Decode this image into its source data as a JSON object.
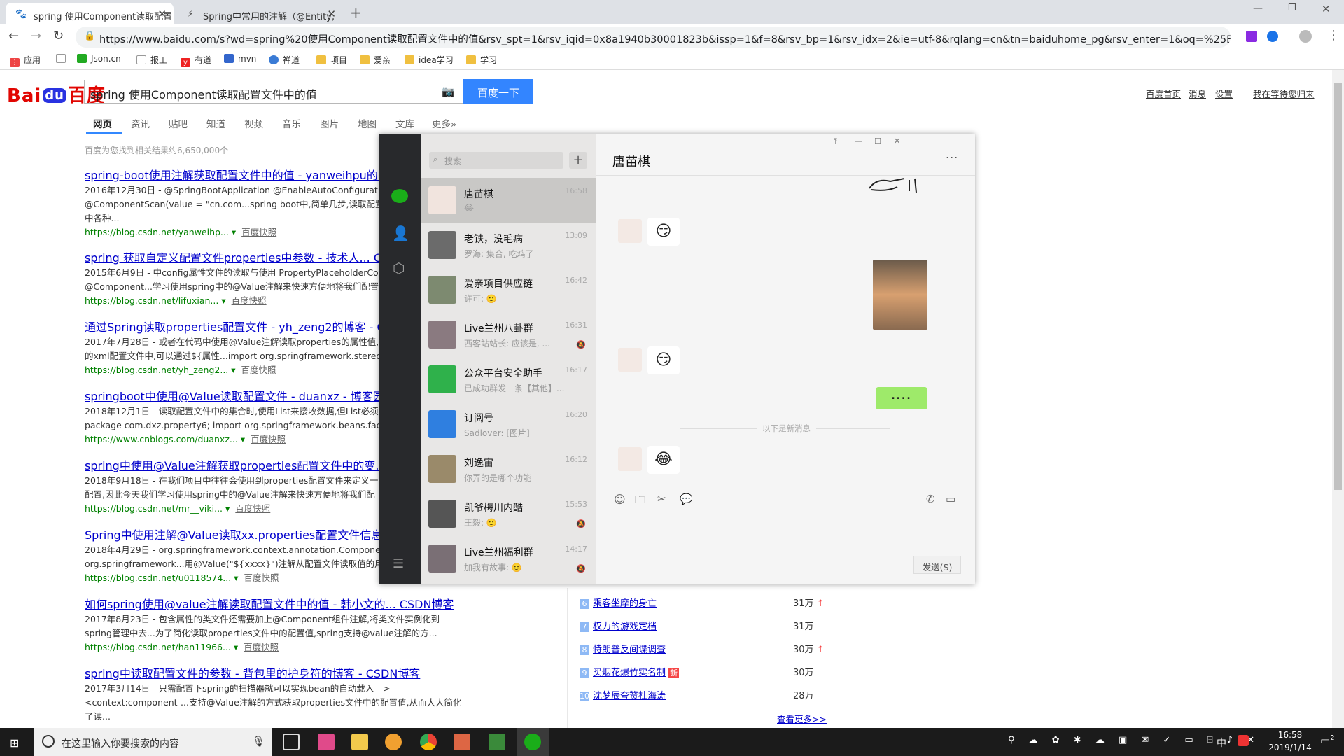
{
  "browser": {
    "tabs": [
      {
        "title": "spring 使用Component读取配置",
        "active": true
      },
      {
        "title": "Spring中常用的注解（@Entity,",
        "active": false
      }
    ],
    "url": "https://www.baidu.com/s?wd=spring%20使用Component读取配置文件中的值&rsv_spt=1&rsv_iqid=0x8a1940b30001823b&issp=1&f=8&rsv_bp=1&rsv_idx=2&ie=utf-8&rqlang=cn&tn=baiduhome_pg&rsv_enter=1&oq=%25E5%25AE...",
    "bookmarks": [
      "应用",
      "Json.cn",
      "报工",
      "有道",
      "mvn",
      "禅道",
      "项目",
      "爱亲",
      "idea学习",
      "学习"
    ]
  },
  "baidu": {
    "logo_left": "Bai",
    "logo_du": "du",
    "logo_right": "百度",
    "query": "spring 使用Component读取配置文件中的值",
    "search_button": "百度一下",
    "top_links": [
      "百度首页",
      "消息",
      "设置",
      "我在等待您归来"
    ],
    "nav": [
      "网页",
      "资讯",
      "贴吧",
      "知道",
      "视频",
      "音乐",
      "图片",
      "地图",
      "文库",
      "更多»"
    ],
    "result_count": "百度为您找到相关结果约6,650,000个",
    "results": [
      {
        "title": "spring-boot使用注解获取配置文件中的值 - yanweihpu的...",
        "desc1": "2016年12月30日 - @SpringBootApplication @EnableAutoConfiguration",
        "desc2": "@ComponentScan(value = \"cn.com...spring boot中,简单几步,读取配置文件",
        "desc3": "中各种...",
        "url": "https://blog.csdn.net/yanweihp...",
        "snap": "百度快照"
      },
      {
        "title": "spring 获取自定义配置文件properties中参数 - 技术人... CSDN",
        "desc1": "2015年6月9日 - 中config属性文件的读取与使用 PropertyPlaceholderConfigurer",
        "desc2": "@Component...学习使用spring中的@Value注解来快速方便地将我们配置",
        "desc3": "",
        "url": "https://blog.csdn.net/lifuxian...",
        "snap": "百度快照"
      },
      {
        "title": "通过Spring读取properties配置文件 - yh_zeng2的博客 - CSDN",
        "desc1": "2017年7月28日 - 或者在代码中使用@Value注解读取properties的属性值,",
        "desc2": "的xml配置文件中,可以通过${属性...import org.springframework.stereotype",
        "desc3": "",
        "url": "https://blog.csdn.net/yh_zeng2...",
        "snap": "百度快照"
      },
      {
        "title": "springboot中使用@Value读取配置文件 - duanxz - 博客园",
        "desc1": "2018年12月1日 - 读取配置文件中的集合时,使用List来接收数据,但List必须",
        "desc2": "package com.dxz.property6; import org.springframework.beans.factory.an",
        "desc3": "",
        "url": "https://www.cnblogs.com/duanxz...",
        "snap": "百度快照"
      },
      {
        "title": "spring中使用@Value注解获取properties配置文件中的变...",
        "desc1": "2018年9月18日 - 在我们项目中往往会使用到properties配置文件来定义一",
        "desc2": "配置,因此今天我们学习使用spring中的@Value注解来快速方便地将我们配",
        "desc3": "",
        "url": "https://blog.csdn.net/mr__viki...",
        "snap": "百度快照"
      },
      {
        "title": "Spring中使用注解@Value读取xx.properties配置文件信息...",
        "desc1": "2018年4月29日 - org.springframework.context.annotation.ComponentScan",
        "desc2": "org.springframework...用@Value(\"${xxxx}\")注解从配置文件读取值的用法",
        "desc3": "",
        "url": "https://blog.csdn.net/u0118574...",
        "snap": "百度快照"
      },
      {
        "title": "如何spring使用@value注解读取配置文件中的值 - 韩小文的... CSDN博客",
        "desc1": "2017年8月23日 - 包含属性的类文件还需要加上@Component组件注解,将类文件实例化到",
        "desc2": "spring管理中去...为了简化读取properties文件中的配置值,spring支持@value注解的方...",
        "desc3": "",
        "url": "https://blog.csdn.net/han11966...",
        "snap": "百度快照"
      },
      {
        "title": "spring中读取配置文件的参数 - 背包里的护身符的博客 - CSDN博客",
        "desc1": "2017年3月14日 - 只需配置下spring的扫描器就可以实现bean的自动载入 -->",
        "desc2": "<context:component-...支持@Value注解的方式获取properties文件中的配置值,从而大大简化",
        "desc3": "了读...",
        "url": "",
        "snap": ""
      }
    ],
    "hot_list": [
      {
        "rank": "6",
        "title": "乘客坐摩的身亡",
        "count": "31万",
        "up": true,
        "new": false
      },
      {
        "rank": "7",
        "title": "权力的游戏定档",
        "count": "31万",
        "up": false,
        "new": false
      },
      {
        "rank": "8",
        "title": "特朗普反间谍调查",
        "count": "30万",
        "up": true,
        "new": false
      },
      {
        "rank": "9",
        "title": "买烟花爆竹实名制",
        "count": "30万",
        "up": false,
        "new": true
      },
      {
        "rank": "10",
        "title": "沈梦辰夸赞杜海涛",
        "count": "28万",
        "up": false,
        "new": false
      }
    ],
    "hot_more": "查看更多>>",
    "new_badge": "新"
  },
  "wechat": {
    "search_placeholder": "搜索",
    "conversations": [
      {
        "name": "唐苗棋",
        "preview": "😂",
        "time": "16:58",
        "muted": false,
        "color": "#f1e4de"
      },
      {
        "name": "老铁，没毛病",
        "preview": "罗海: 集合, 吃鸡了",
        "time": "13:09",
        "muted": false,
        "color": "#6b6b6b"
      },
      {
        "name": "爱亲项目供应链",
        "preview": "许可: 🙂",
        "time": "16:42",
        "muted": false,
        "color": "#7d8a70"
      },
      {
        "name": "Live兰州八卦群",
        "preview": "西客站站长: 应该是, ...",
        "time": "16:31",
        "muted": true,
        "color": "#8a7a80"
      },
      {
        "name": "公众平台安全助手",
        "preview": "已成功群发一条【其他】...",
        "time": "16:17",
        "muted": false,
        "color": "#2fb14b"
      },
      {
        "name": "订阅号",
        "preview": "Sadlover: [图片]",
        "time": "16:20",
        "muted": false,
        "color": "#2f7fe0"
      },
      {
        "name": "刘逸宙",
        "preview": "你弄的是哪个功能",
        "time": "16:12",
        "muted": false,
        "color": "#9a8a6a"
      },
      {
        "name": "凯爷梅川内酷",
        "preview": "王毅: 🙂",
        "time": "15:53",
        "muted": true,
        "color": "#555"
      },
      {
        "name": "Live兰州福利群",
        "preview": "加我有故事: 🙂",
        "time": "14:17",
        "muted": true,
        "color": "#7a6f75"
      }
    ],
    "chat_title": "唐苗棋",
    "more": "...",
    "new_msgs_divider": "以下是新消息",
    "my_bubble": "....",
    "send_button": "发送(S)",
    "window_controls": [
      "⤒",
      "—",
      "☐",
      "✕"
    ]
  },
  "taskbar": {
    "search_placeholder": "在这里输入你要搜索的内容",
    "time": "16:58",
    "date": "2019/1/14",
    "ime": "中",
    "notif_count": "2"
  }
}
